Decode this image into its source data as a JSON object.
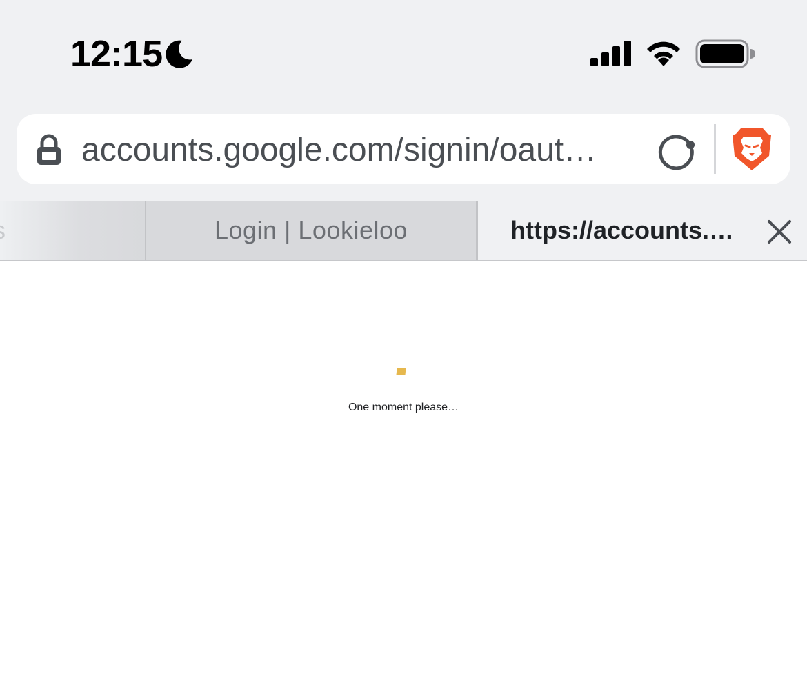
{
  "status_bar": {
    "time": "12:15",
    "icons": [
      "moon-icon",
      "signal-bars-icon",
      "wifi-icon",
      "battery-icon"
    ]
  },
  "address_bar": {
    "url": "accounts.google.com/signin/oaut…",
    "icons": [
      "lock-icon",
      "reload-icon",
      "brave-shields-icon"
    ]
  },
  "tabs": [
    {
      "label": "s",
      "state": "inactive"
    },
    {
      "label": "Login | Lookieloo",
      "state": "inactive"
    },
    {
      "label": "https://accounts.…",
      "state": "active"
    }
  ],
  "page": {
    "loading_text": "One moment please…"
  },
  "colors": {
    "chrome_bg": "#f0f1f3",
    "inactive_tab_bg": "#d8d9dc",
    "brave_orange": "#f1562b",
    "loader_yellow": "#e6b84e"
  }
}
